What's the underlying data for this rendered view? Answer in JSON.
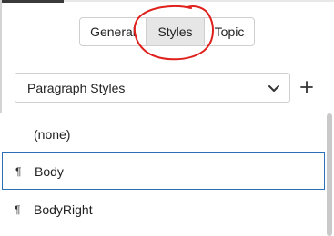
{
  "tabs": [
    {
      "label": "General",
      "selected": false
    },
    {
      "label": "Styles",
      "selected": true
    },
    {
      "label": "Topic",
      "selected": false
    }
  ],
  "style_type_select": {
    "value": "Paragraph Styles",
    "icon": "chevron-down-icon"
  },
  "add_button": {
    "icon": "plus-icon"
  },
  "style_list": {
    "items": [
      {
        "label": "(none)",
        "icon": "",
        "selected": false
      },
      {
        "label": "Body",
        "icon": "pilcrow-icon",
        "glyph": "¶",
        "selected": true
      },
      {
        "label": "BodyRight",
        "icon": "pilcrow-icon",
        "glyph": "¶",
        "selected": false
      }
    ]
  },
  "colors": {
    "selection_border": "#2c6fb7",
    "selected_tab_bg": "#e6e6e6",
    "annotation": "#e0201b"
  }
}
